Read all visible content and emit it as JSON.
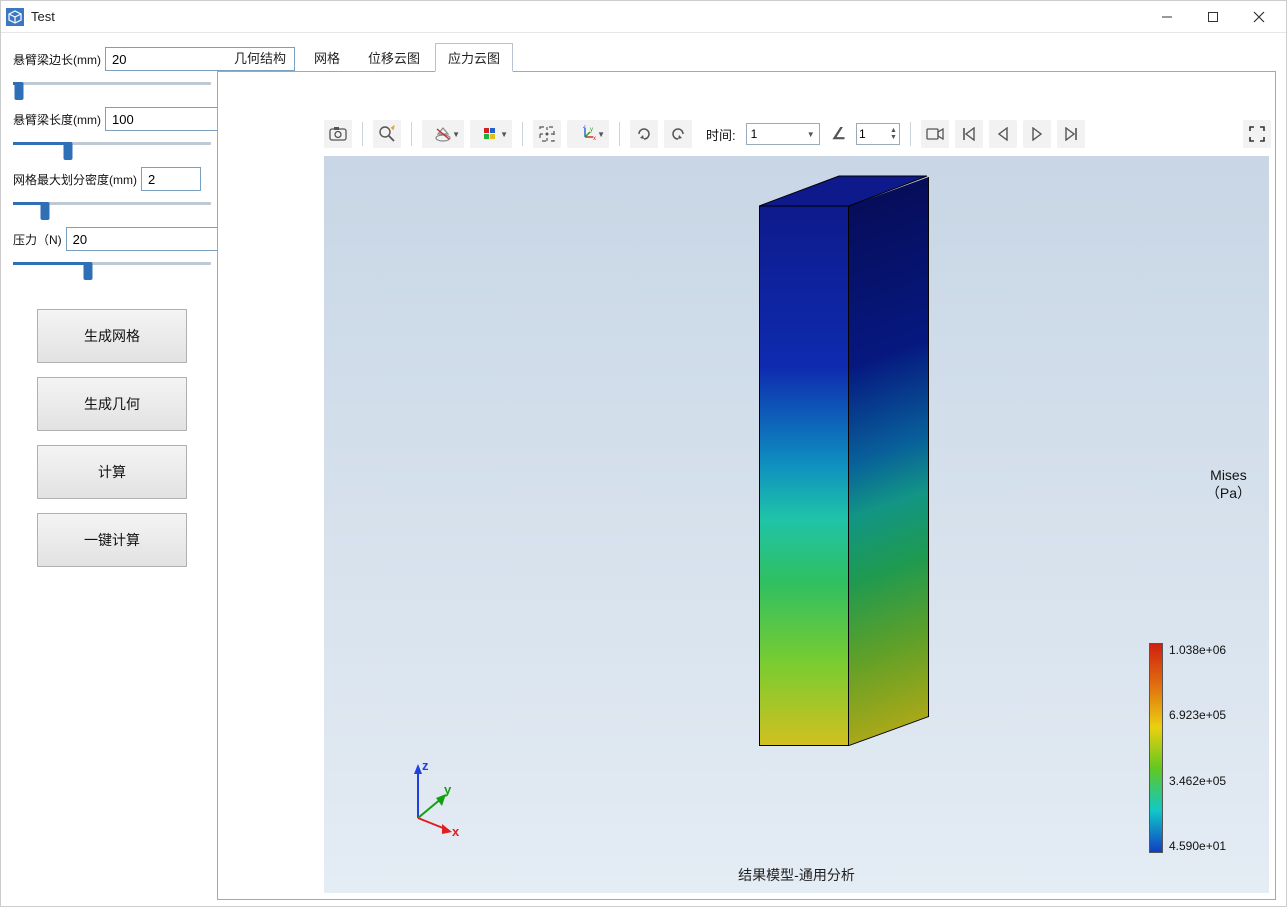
{
  "window": {
    "title": "Test"
  },
  "sidebar": {
    "params": {
      "edge_label": "悬臂梁边长(mm)",
      "edge_value": "20",
      "edge_fill": 3,
      "length_label": "悬臂梁长度(mm)",
      "length_value": "100",
      "length_fill": 28,
      "mesh_label": "网格最大划分密度(mm)",
      "mesh_value": "2",
      "mesh_fill": 16,
      "force_label": "压力（N)",
      "force_value": "20",
      "force_fill": 38
    },
    "buttons": {
      "gen_mesh": "生成网格",
      "gen_geom": "生成几何",
      "compute": "计算",
      "one_click": "一键计算"
    }
  },
  "tabs": {
    "items": [
      {
        "label": "几何结构",
        "active": false
      },
      {
        "label": "网格",
        "active": false
      },
      {
        "label": "位移云图",
        "active": false
      },
      {
        "label": "应力云图",
        "active": true
      }
    ]
  },
  "toolbar": {
    "time_label": "时间:",
    "time_value": "1",
    "step_value": "1"
  },
  "viewer": {
    "caption": "结果模型-通用分析"
  },
  "legend": {
    "title_line1": "Mises",
    "title_line2": "（Pa）",
    "values": [
      "1.038e+06",
      "6.923e+05",
      "3.462e+05",
      "4.590e+01"
    ]
  }
}
